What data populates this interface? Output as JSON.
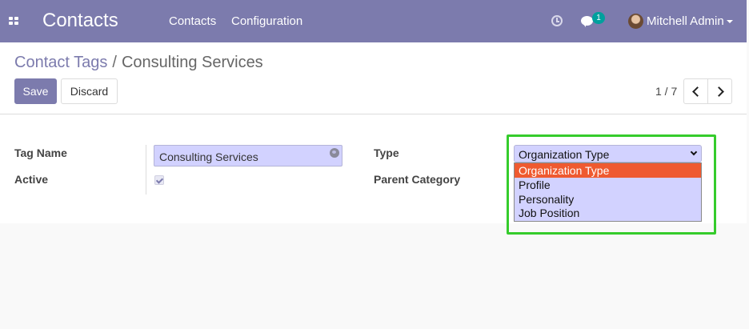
{
  "navbar": {
    "app_title": "Contacts",
    "menu": [
      "Contacts",
      "Configuration"
    ],
    "messages_count": "1",
    "user_name": "Mitchell Admin"
  },
  "breadcrumb": {
    "parent": "Contact Tags",
    "separator": "/",
    "current": "Consulting Services"
  },
  "buttons": {
    "save": "Save",
    "discard": "Discard"
  },
  "pager": {
    "value": "1 / 7"
  },
  "form": {
    "tag_name_label": "Tag Name",
    "tag_name_value": "Consulting Services",
    "active_label": "Active",
    "active_checked": true,
    "type_label": "Type",
    "type_value": "Organization Type",
    "parent_category_label": "Parent Category",
    "type_options": [
      "Organization Type",
      "Profile",
      "Personality",
      "Job Position"
    ]
  },
  "colors": {
    "navbar": "#7c7bad",
    "accent": "#7c7bad",
    "field_bg": "#d2d2ff",
    "option_highlight": "#ef5a30",
    "annotation_frame": "#35cc2c",
    "badge": "#00a09d"
  }
}
